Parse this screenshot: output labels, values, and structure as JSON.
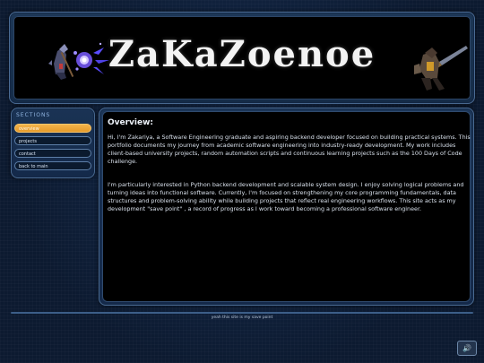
{
  "banner": {
    "title": "ZaKaZoenoe"
  },
  "sidebar": {
    "heading": "SECTIONS",
    "items": [
      {
        "label": "overview",
        "active": true
      },
      {
        "label": "projects",
        "active": false
      },
      {
        "label": "contact",
        "active": false
      },
      {
        "label": "back to main",
        "active": false
      }
    ]
  },
  "main": {
    "heading": "Overview:",
    "paragraphs": [
      "Hi, I'm Zakariya, a Software Engineering graduate and aspiring backend developer focused on building practical systems. This portfolio documents my journey from academic software engineering into industry-ready development. My work includes client-based university projects, random automation scripts and continuous learning projects such as the 100 Days of Code challenge.",
      "I'm particularly interested in Python backend development and scalable system design. I enjoy solving logical problems and turning ideas into functional software. Currently, I'm focused on strengthening my core programming fundamentals, data structures and problem-solving ability while building projects that reflect real engineering workflows. This site acts as my development \"save point\" , a record of progress as I work toward becoming a professional software engineer."
    ]
  },
  "footer": {
    "text": "yeah this site is my save point"
  },
  "sound": {
    "icon": "speaker-icon",
    "glyph": "🔊"
  },
  "colors": {
    "accent": "#f0a83a",
    "panel": "#1a3354",
    "border": "#4a6b93",
    "background": "#0c1a30"
  }
}
